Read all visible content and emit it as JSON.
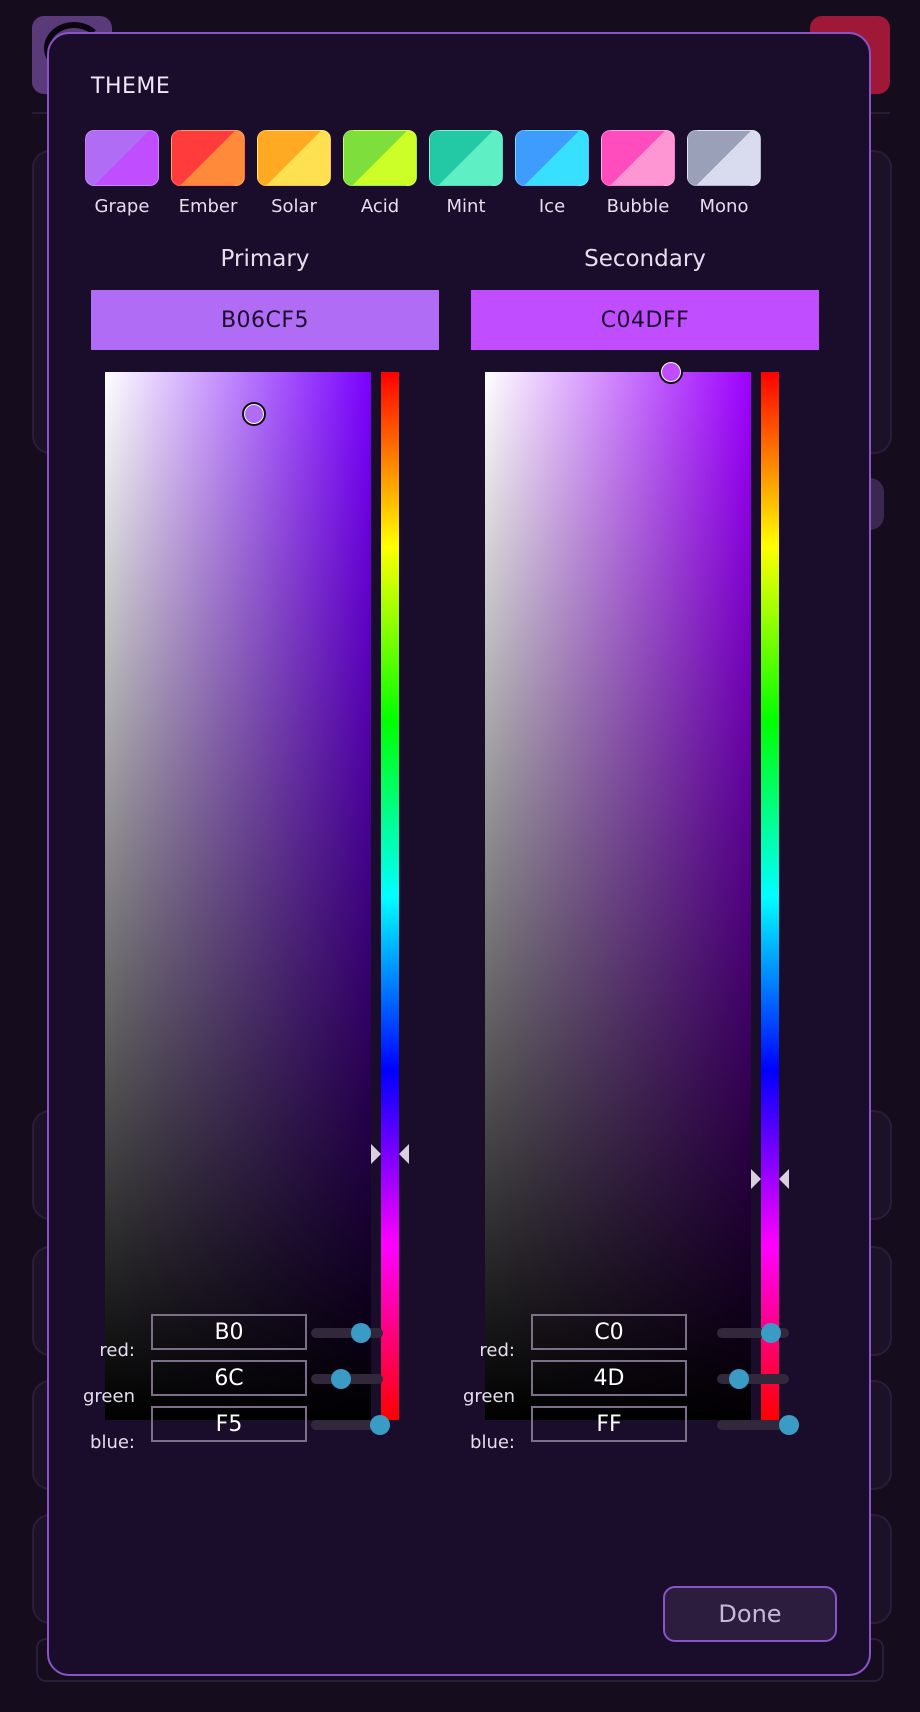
{
  "theme": {
    "title": "THEME",
    "swatches": [
      {
        "label": "Grape",
        "c1": "#b06cf5",
        "c2": "#c04dff"
      },
      {
        "label": "Ember",
        "c1": "#ff3b3b",
        "c2": "#ff8a3a"
      },
      {
        "label": "Solar",
        "c1": "#ffaa22",
        "c2": "#ffe050"
      },
      {
        "label": "Acid",
        "c1": "#7ede3c",
        "c2": "#ccff28"
      },
      {
        "label": "Mint",
        "c1": "#22c9a4",
        "c2": "#5ef0c4"
      },
      {
        "label": "Ice",
        "c1": "#3e9cff",
        "c2": "#37e0ff"
      },
      {
        "label": "Bubble",
        "c1": "#ff4dbe",
        "c2": "#ff96d4"
      },
      {
        "label": "Mono",
        "c1": "#9aa0b8",
        "c2": "#d8dcee"
      }
    ]
  },
  "primary": {
    "title": "Primary",
    "hex": "B06CF5",
    "color": "#b06cf5",
    "hue_color": "#7a00ff",
    "saturation": 0.56,
    "value": 0.96,
    "hue_fraction": 0.746,
    "rgb": {
      "red_label": "red:",
      "red": "B0",
      "red_fraction": 0.69,
      "green_label": "green",
      "green": "6C",
      "green_fraction": 0.42,
      "blue_label": "blue:",
      "blue": "F5",
      "blue_fraction": 0.96
    }
  },
  "secondary": {
    "title": "Secondary",
    "hex": "C04DFF",
    "color": "#c04dff",
    "hue_color": "#9d00ff",
    "saturation": 0.7,
    "value": 1.0,
    "hue_fraction": 0.77,
    "rgb": {
      "red_label": "red:",
      "red": "C0",
      "red_fraction": 0.75,
      "green_label": "green",
      "green": "4D",
      "green_fraction": 0.3,
      "blue_label": "blue:",
      "blue": "FF",
      "blue_fraction": 1.0
    }
  },
  "done_label": "Done"
}
